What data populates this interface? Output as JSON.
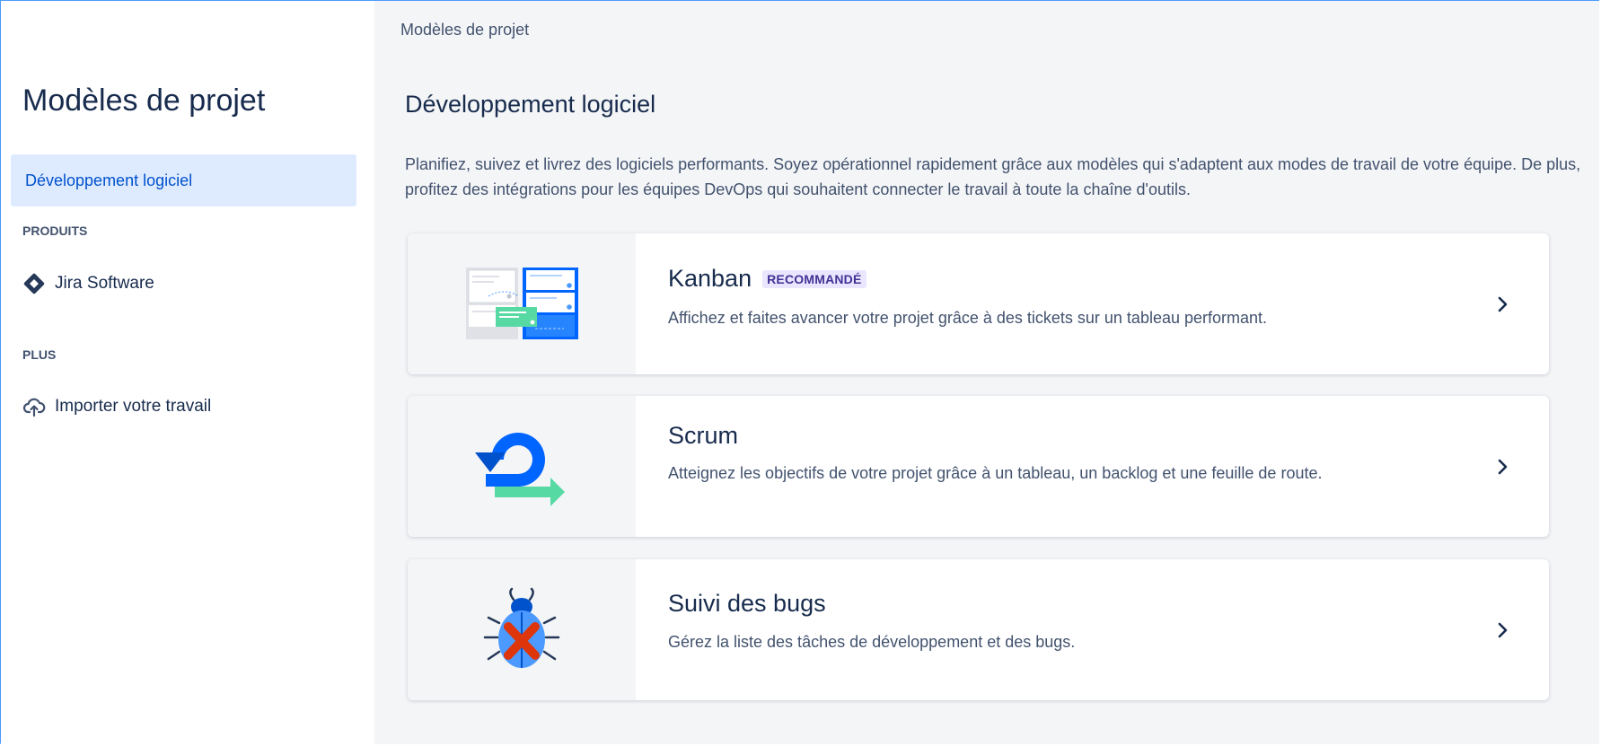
{
  "breadcrumb": "Modèles de projet",
  "sidebar": {
    "title": "Modèles de projet",
    "selected_item": "Développement logiciel",
    "sections": [
      {
        "label": "PRODUITS",
        "items": [
          {
            "label": "Jira Software",
            "icon": "jira-software-icon"
          }
        ]
      },
      {
        "label": "PLUS",
        "items": [
          {
            "label": "Importer votre travail",
            "icon": "cloud-upload-icon"
          }
        ]
      }
    ]
  },
  "main": {
    "title": "Développement logiciel",
    "description": "Planifiez, suivez et livrez des logiciels performants. Soyez opérationnel rapidement grâce aux modèles qui s'adaptent aux modes de travail de votre équipe. De plus, profitez des intégrations pour les équipes DevOps qui souhaitent connecter le travail à toute la chaîne d'outils.",
    "templates": [
      {
        "title": "Kanban",
        "badge": "RECOMMANDÉ",
        "description": "Affichez et faites avancer votre projet grâce à des tickets sur un tableau performant.",
        "icon": "kanban-board-illustration"
      },
      {
        "title": "Scrum",
        "badge": "",
        "description": "Atteignez les objectifs de votre projet grâce à un tableau, un backlog et une feuille de route.",
        "icon": "scrum-cycle-illustration"
      },
      {
        "title": "Suivi des bugs",
        "badge": "",
        "description": "Gérez la liste des tâches de développement et des bugs.",
        "icon": "bug-tracking-illustration"
      }
    ]
  },
  "colors": {
    "accent": "#0052cc",
    "selected_bg": "#deebff",
    "badge_bg": "#eae6ff",
    "badge_text": "#403294"
  }
}
